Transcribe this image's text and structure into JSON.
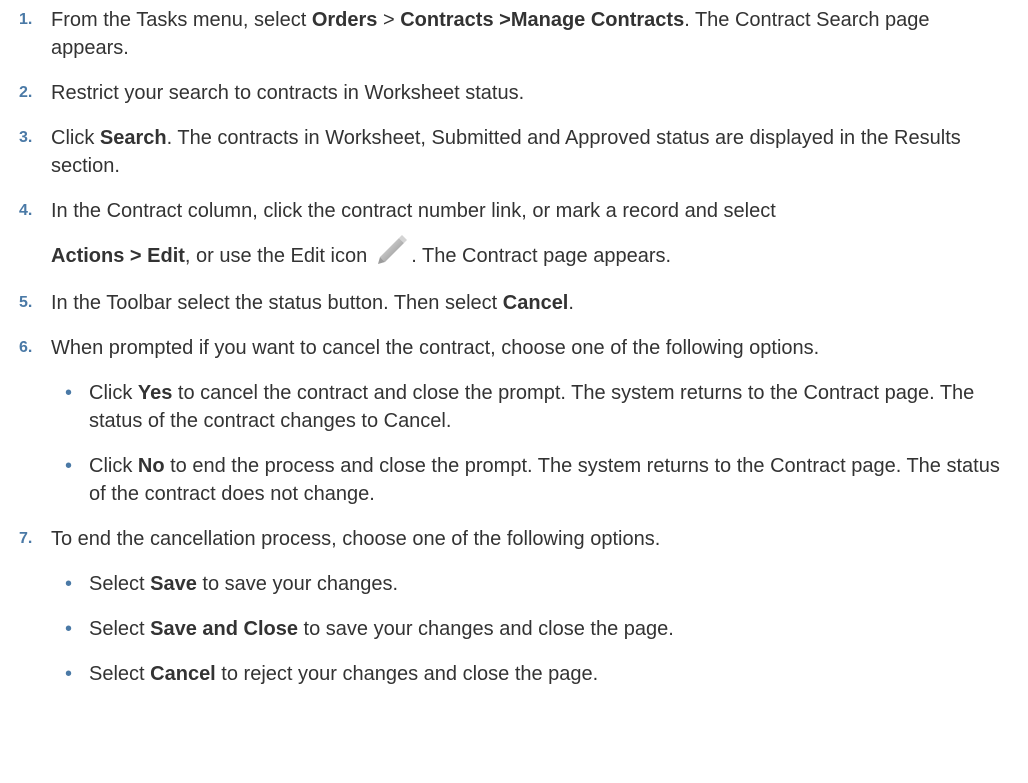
{
  "steps": [
    {
      "num": "1.",
      "parts": [
        {
          "t": "From the Tasks menu, select "
        },
        {
          "b": "Orders"
        },
        {
          "t": " > "
        },
        {
          "b": "Contracts >Manage Contracts"
        },
        {
          "t": ". The Contract Search page appears."
        }
      ]
    },
    {
      "num": "2.",
      "parts": [
        {
          "t": "Restrict your search to contracts in Worksheet status."
        }
      ]
    },
    {
      "num": "3.",
      "parts": [
        {
          "t": "Click "
        },
        {
          "b": "Search"
        },
        {
          "t": ". The contracts in Worksheet, Submitted and Approved status are displayed in the Results section."
        }
      ]
    },
    {
      "num": "4.",
      "line1": "In the Contract column, click the contract number link, or mark a record and select",
      "line2_bold": "Actions > Edit",
      "line2_mid": ", or use the Edit icon",
      "line2_end": ". The Contract page appears.",
      "icon": "pencil-edit-icon"
    },
    {
      "num": "5.",
      "parts": [
        {
          "t": "In the Toolbar select the status button. Then select "
        },
        {
          "b": "Cancel"
        },
        {
          "t": "."
        }
      ]
    },
    {
      "num": "6.",
      "parts": [
        {
          "t": "When prompted if you want to cancel the contract, choose one of the following options."
        }
      ],
      "options": [
        [
          {
            "t": "Click "
          },
          {
            "b": "Yes"
          },
          {
            "t": " to cancel the contract and close the prompt. The system returns to the Contract page. The status of the contract changes to Cancel."
          }
        ],
        [
          {
            "t": "Click "
          },
          {
            "b": "No"
          },
          {
            "t": " to end the process and close the prompt. The system returns to the Contract page. The status of the contract does not change."
          }
        ]
      ]
    },
    {
      "num": "7.",
      "parts": [
        {
          "t": "To end the cancellation process, choose one of the following options."
        }
      ],
      "options": [
        [
          {
            "t": "Select "
          },
          {
            "b": "Save"
          },
          {
            "t": " to save your changes."
          }
        ],
        [
          {
            "t": "Select "
          },
          {
            "b": "Save and Close"
          },
          {
            "t": " to save your changes and close the page."
          }
        ],
        [
          {
            "t": "Select "
          },
          {
            "b": "Cancel"
          },
          {
            "t": " to reject your changes and close the page."
          }
        ]
      ]
    }
  ],
  "colors": {
    "step_number": "#4a79a6",
    "bullet": "#4a79a6",
    "text": "#333333"
  },
  "bullet_char": "•"
}
